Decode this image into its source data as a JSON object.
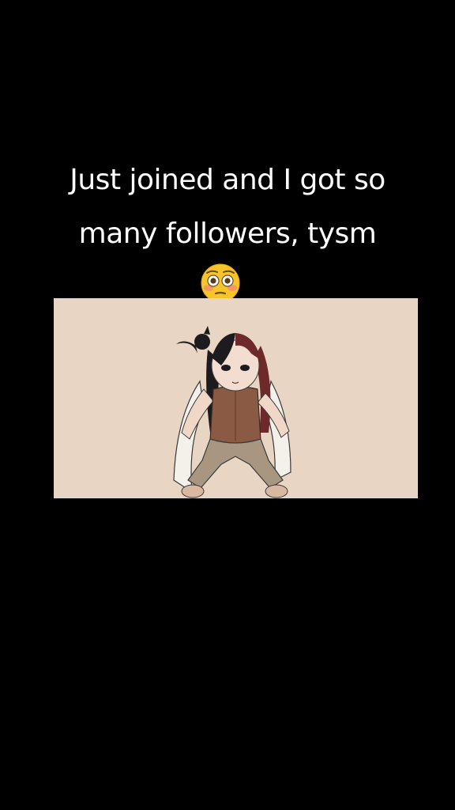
{
  "caption": {
    "line1": "Just joined and I got so",
    "line2": "many followers, tysm"
  },
  "emoji": {
    "name": "flushed-face-emoji",
    "color": "#f7c52a"
  },
  "video": {
    "background_color": "#e8d5c3",
    "content": "gacha-character-illustration"
  },
  "colors": {
    "background": "#000000",
    "text": "#ffffff"
  }
}
